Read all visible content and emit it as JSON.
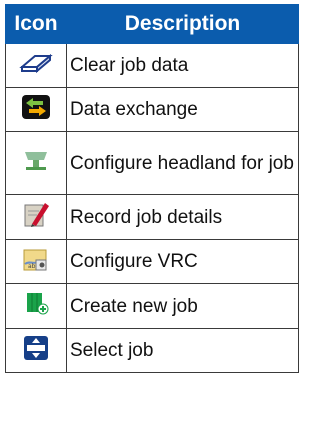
{
  "table": {
    "header_icon": "Icon",
    "header_description": "Description",
    "rows": [
      {
        "icon": "eraser-icon",
        "description": "Clear job data"
      },
      {
        "icon": "data-exchange-icon",
        "description": "Data exchange"
      },
      {
        "icon": "headland-icon",
        "description": "Configure headland for job"
      },
      {
        "icon": "job-details-icon",
        "description": "Record job details"
      },
      {
        "icon": "vrc-map-icon",
        "description": "Configure VRC"
      },
      {
        "icon": "new-job-icon",
        "description": "Create new job"
      },
      {
        "icon": "select-job-icon",
        "description": "Select job"
      }
    ]
  },
  "colors": {
    "header_bg": "#0b5cad",
    "header_text": "#ffffff",
    "border": "#3a3a3a"
  }
}
